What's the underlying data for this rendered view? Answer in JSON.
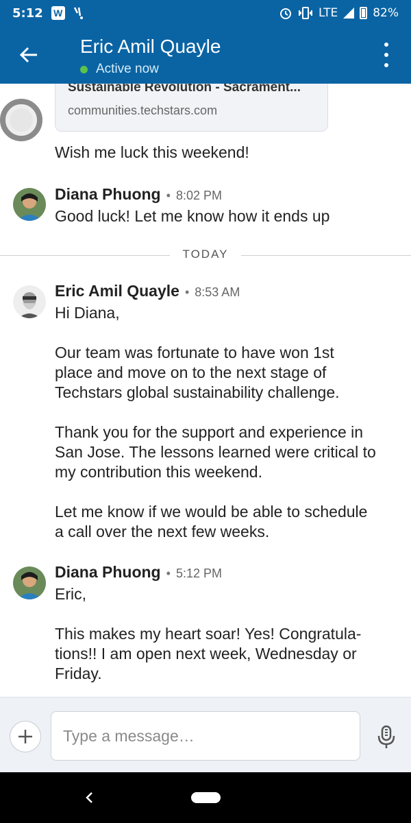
{
  "status_bar": {
    "time": "5:12",
    "app_badge": "W",
    "network": "LTE",
    "battery": "82%"
  },
  "header": {
    "contact_name": "Eric Amil Quayle",
    "presence": "Active now"
  },
  "link_preview": {
    "title": "Sustainable Revolution - Sacrament...",
    "url": "communities.techstars.com"
  },
  "messages": [
    {
      "type": "text",
      "text": "Wish me luck this weekend!"
    },
    {
      "type": "message",
      "sender": "Diana Phuong",
      "time": "8:02 PM",
      "text": "Good luck! Let me know how it ends up"
    },
    {
      "type": "divider",
      "label": "TODAY"
    },
    {
      "type": "message",
      "sender": "Eric Amil Quayle",
      "time": "8:53 AM",
      "text": "Hi Diana,\n\nOur team was fortunate to have won 1st\nplace and move on to the next stage of\nTechstars global sustainability challenge.\n\nThank you for the support and experience in\nSan Jose. The lessons learned were critical to\nmy contribution this weekend.\n\nLet me know if we would be able to schedule\na call over the next few weeks."
    },
    {
      "type": "message",
      "sender": "Diana Phuong",
      "time": "5:12 PM",
      "text": "Eric,\n\nThis makes my heart soar! Yes! Congratula-\ntions!! I am open next week, Wednesday or\nFriday."
    }
  ],
  "composer": {
    "placeholder": "Type a message…"
  },
  "icons": {
    "back": "arrow-left-icon",
    "more": "more-vert-icon",
    "add": "plus-icon",
    "mic": "microphone-icon"
  },
  "colors": {
    "brand": "#0a64a4",
    "active": "#5cc24a"
  }
}
